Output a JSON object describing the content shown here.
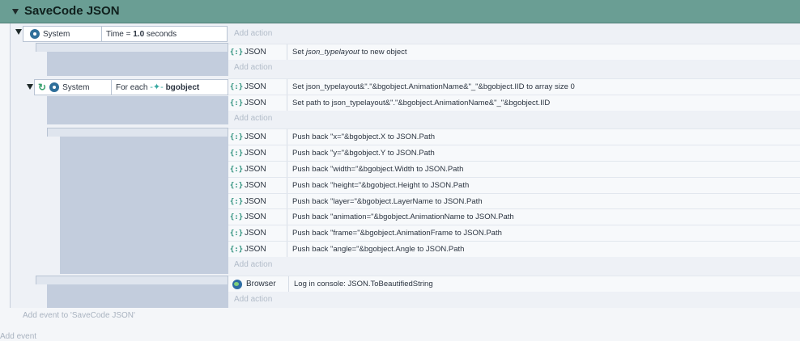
{
  "group": {
    "title": "SaveCode JSON"
  },
  "add_action": "Add action",
  "add_event_to_group": "Add event to 'SaveCode JSON'",
  "add_event": "Add event",
  "event1": {
    "condition": {
      "object": "System",
      "label_prefix": "Time = ",
      "value": "1.0",
      "label_suffix": " seconds"
    },
    "actions": [
      {
        "object": "JSON",
        "icon": "{:}",
        "text_pre": "Set ",
        "var": "json_typelayout",
        "text_post": " to new object"
      }
    ]
  },
  "event2": {
    "condition": {
      "object": "System",
      "label_prefix": "For each ",
      "target": "bgobject"
    },
    "actions": [
      {
        "object": "JSON",
        "icon": "{:}",
        "text": "Set json_typelayout&\".\"&bgobject.AnimationName&\"_\"&bgobject.IID to array size 0"
      },
      {
        "object": "JSON",
        "icon": "{:}",
        "text": "Set path to json_typelayout&\".\"&bgobject.AnimationName&\"_\"&bgobject.IID"
      }
    ]
  },
  "event3": {
    "actions": [
      {
        "object": "JSON",
        "icon": "{:}",
        "text": "Push back \"x=\"&bgobject.X to JSON.Path"
      },
      {
        "object": "JSON",
        "icon": "{:}",
        "text": "Push back \"y=\"&bgobject.Y to JSON.Path"
      },
      {
        "object": "JSON",
        "icon": "{:}",
        "text": "Push back \"width=\"&bgobject.Width to JSON.Path"
      },
      {
        "object": "JSON",
        "icon": "{:}",
        "text": "Push back \"height=\"&bgobject.Height to JSON.Path"
      },
      {
        "object": "JSON",
        "icon": "{:}",
        "text": "Push back \"layer=\"&bgobject.LayerName to JSON.Path"
      },
      {
        "object": "JSON",
        "icon": "{:}",
        "text": "Push back \"animation=\"&bgobject.AnimationName to JSON.Path"
      },
      {
        "object": "JSON",
        "icon": "{:}",
        "text": "Push back \"frame=\"&bgobject.AnimationFrame to JSON.Path"
      },
      {
        "object": "JSON",
        "icon": "{:}",
        "text": "Push back \"angle=\"&bgobject.Angle to JSON.Path"
      }
    ]
  },
  "event4": {
    "actions": [
      {
        "object": "Browser",
        "text": "Log in console: JSON.ToBeautifiedString"
      }
    ]
  }
}
